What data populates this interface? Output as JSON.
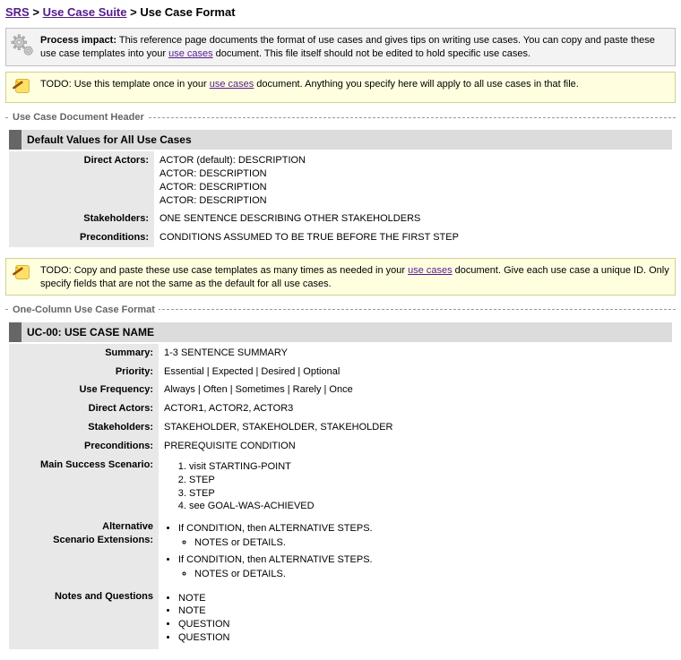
{
  "breadcrumb": {
    "srs": "SRS",
    "suite": "Use Case Suite",
    "current": "Use Case Format"
  },
  "process_impact": {
    "label": "Process impact:",
    "text_a": "This reference page documents the format of use cases and gives tips on writing use cases. You can copy and paste these use case templates into your ",
    "use_cases_link": "use cases",
    "text_b": " document. This file itself should not be edited to hold specific use cases."
  },
  "todo1": {
    "prefix": "TODO: Use this template once in your ",
    "link": "use cases",
    "suffix": " document. Anything you specify here will apply to all use cases in that file."
  },
  "header_section": {
    "legend": "Use Case Document Header",
    "block_title": "Default Values for All Use Cases",
    "rows": {
      "direct_actors": {
        "k": "Direct Actors:",
        "v": "ACTOR (default): DESCRIPTION\nACTOR: DESCRIPTION\nACTOR: DESCRIPTION\nACTOR: DESCRIPTION"
      },
      "stakeholders": {
        "k": "Stakeholders:",
        "v": "ONE SENTENCE DESCRIBING OTHER STAKEHOLDERS"
      },
      "preconditions": {
        "k": "Preconditions:",
        "v": "CONDITIONS ASSUMED TO BE TRUE BEFORE THE FIRST STEP"
      }
    }
  },
  "todo2": {
    "prefix": "TODO: Copy and paste these use case templates as many times as needed in your ",
    "link": "use cases",
    "suffix": " document. Give each use case a unique ID. Only specify fields that are not the same as the default for all use cases."
  },
  "onecol": {
    "legend": "One-Column Use Case Format",
    "block_title": "UC-00: USE CASE NAME",
    "rows": {
      "summary": {
        "k": "Summary:",
        "v": "1-3 SENTENCE SUMMARY"
      },
      "priority": {
        "k": "Priority:",
        "v": "Essential | Expected | Desired | Optional"
      },
      "use_frequency": {
        "k": "Use Frequency:",
        "v": "Always | Often | Sometimes | Rarely | Once"
      },
      "direct_actors": {
        "k": "Direct Actors:",
        "v": "ACTOR1, ACTOR2, ACTOR3"
      },
      "stakeholders": {
        "k": "Stakeholders:",
        "v": "STAKEHOLDER, STAKEHOLDER, STAKEHOLDER"
      },
      "preconditions": {
        "k": "Preconditions:",
        "v": "PREREQUISITE CONDITION"
      },
      "main_scenario": {
        "k": "Main Success Scenario:"
      },
      "alt_ext": {
        "k": "Alternative\nScenario Extensions:"
      },
      "notes_q": {
        "k": "Notes and Questions"
      }
    },
    "steps": [
      "visit STARTING-POINT",
      "STEP",
      "STEP",
      "see GOAL-WAS-ACHIEVED"
    ],
    "alts": [
      {
        "cond": "If CONDITION, then ALTERNATIVE STEPS.",
        "note": "NOTES or DETAILS."
      },
      {
        "cond": "If CONDITION, then ALTERNATIVE STEPS.",
        "note": "NOTES or DETAILS."
      }
    ],
    "notes": [
      "NOTE",
      "NOTE",
      "QUESTION",
      "QUESTION"
    ]
  }
}
